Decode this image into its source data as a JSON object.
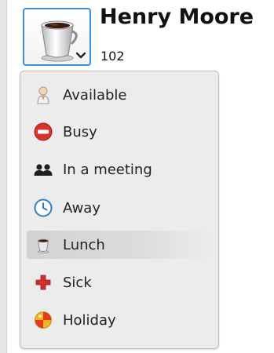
{
  "user": {
    "name": "Henry Moore",
    "extension": "102"
  },
  "status_menu": {
    "selected": "Lunch",
    "items": [
      {
        "label": "Available",
        "icon": "person-icon"
      },
      {
        "label": "Busy",
        "icon": "no-entry-icon"
      },
      {
        "label": "In a meeting",
        "icon": "meeting-people-icon"
      },
      {
        "label": "Away",
        "icon": "clock-icon"
      },
      {
        "label": "Lunch",
        "icon": "coffee-cup-icon"
      },
      {
        "label": "Sick",
        "icon": "red-cross-icon"
      },
      {
        "label": "Holiday",
        "icon": "beach-ball-icon"
      }
    ]
  },
  "colors": {
    "accent": "#3d8fd6",
    "busy": "#d9342b",
    "sick": "#d32f2f",
    "away": "#2f7fc8"
  }
}
